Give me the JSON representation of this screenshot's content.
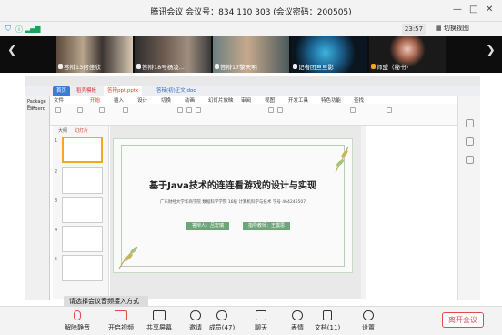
{
  "window": {
    "title": "腾讯会议  会议号：834 110 303  (会议密码：200505)",
    "controls": [
      "—",
      "□",
      "✕"
    ]
  },
  "status": {
    "time": "23:57",
    "switch_view": "切换视图"
  },
  "participants": [
    {
      "name": "答辩13何佳欣"
    },
    {
      "name": "答辩18号杨凌..."
    },
    {
      "name": "答辩17黎天明"
    },
    {
      "name": "记者团旦旦影"
    },
    {
      "name": "师盟（秘书）"
    }
  ],
  "wps": {
    "app_tabs": [
      "首页",
      "稻壳模板",
      "答辩ppt.pptx",
      "答辩(初)正文.doc"
    ],
    "menu": [
      "文件",
      "开始",
      "插入",
      "设计",
      "切换",
      "动画",
      "幻灯片放映",
      "审阅",
      "视图",
      "开发工具",
      "特色功能",
      "查找"
    ],
    "left_nav": [
      "Package Exp",
      "EarBerb"
    ],
    "panel_tabs": [
      "大纲",
      "幻灯片"
    ]
  },
  "slide": {
    "title": "基于Java技术的连连看游戏的设计与实现",
    "subtitle": "广东财经大学华商学院  数据科学学院 16级 计算机科学与技术 学号 464246507",
    "btn_student": "答辩人：吕宏瑞",
    "btn_teacher": "指导教师：王震思"
  },
  "tip": "请选择会议音频接入方式",
  "toolbar": {
    "mute": "解除静音",
    "video": "开启视频",
    "share": "共享屏幕",
    "invite": "邀请",
    "members": "成员(47)",
    "chat": "聊天",
    "reactions": "表情",
    "docs": "文档(11)",
    "settings": "设置",
    "leave": "离开会议"
  }
}
